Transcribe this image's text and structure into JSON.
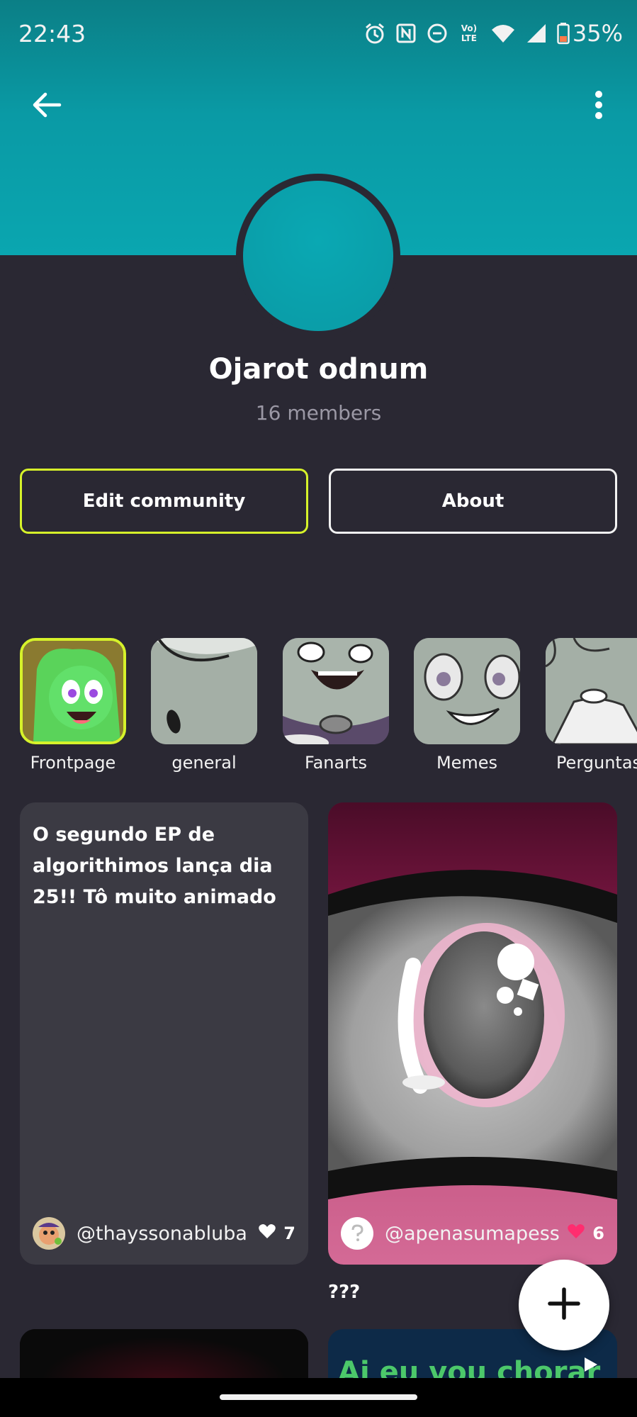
{
  "status_bar": {
    "time": "22:43",
    "battery": "35%",
    "icons": [
      "alarm-icon",
      "nfc-icon",
      "dnd-icon",
      "volte-icon",
      "wifi-icon",
      "signal-icon",
      "battery-icon"
    ],
    "volte_text_top": "Vo)",
    "volte_text_bottom": "LTE"
  },
  "header": {
    "back_icon": "arrow-left-icon",
    "more_icon": "more-vertical-icon"
  },
  "community": {
    "name": "Ojarot odnum",
    "members": "16 members",
    "banner_color": "#0a9aa5",
    "avatar_color": "#0aa8b3"
  },
  "actions": {
    "edit_label": "Edit community",
    "about_label": "About",
    "edit_border_color": "#d6f22a"
  },
  "topics": [
    {
      "label": "Frontpage",
      "selected": true
    },
    {
      "label": "general"
    },
    {
      "label": "Fanarts"
    },
    {
      "label": "Memes"
    },
    {
      "label": "Perguntas"
    }
  ],
  "posts": [
    {
      "text": "O segundo EP de algorithimos lança dia 25!! Tô muito animado",
      "author": "@thayssonabluba",
      "likes": "7",
      "liked": false
    },
    {
      "author": "@apenasumapess",
      "likes": "6",
      "liked": true,
      "caption": "???"
    },
    {
      "headline": "Ai eu vou chorar"
    }
  ],
  "fab": {
    "icon": "plus-icon"
  },
  "colors": {
    "background": "#2a2833",
    "card": "#3b3a43",
    "like_active": "#ff2d6f",
    "accent": "#d6f22a"
  }
}
